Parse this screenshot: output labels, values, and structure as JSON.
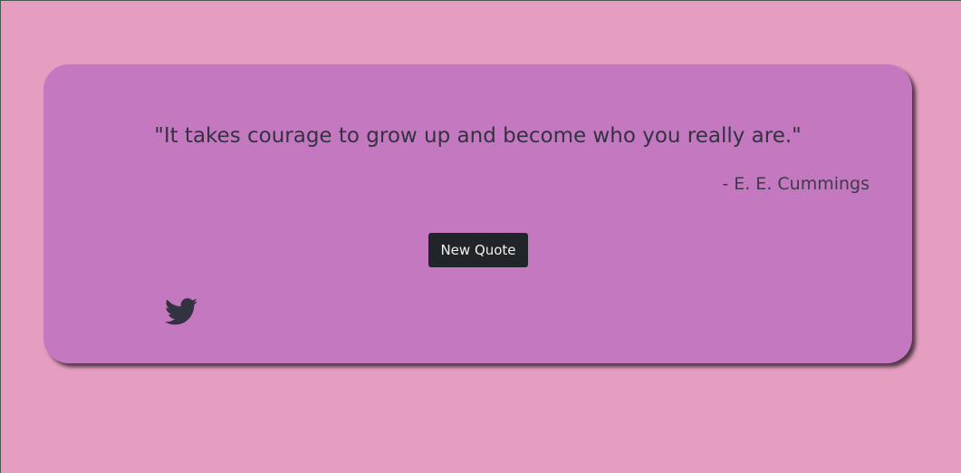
{
  "quote": {
    "text": "\"It takes courage to grow up and become who you really are.\"",
    "author": "- E. E. Cummings"
  },
  "buttons": {
    "new_quote_label": "New Quote"
  },
  "icons": {
    "tweet": "twitter-icon"
  },
  "colors": {
    "page_background": "#e59ec0",
    "card_background": "#c478c0",
    "button_background": "#212529",
    "text": "#333240"
  }
}
